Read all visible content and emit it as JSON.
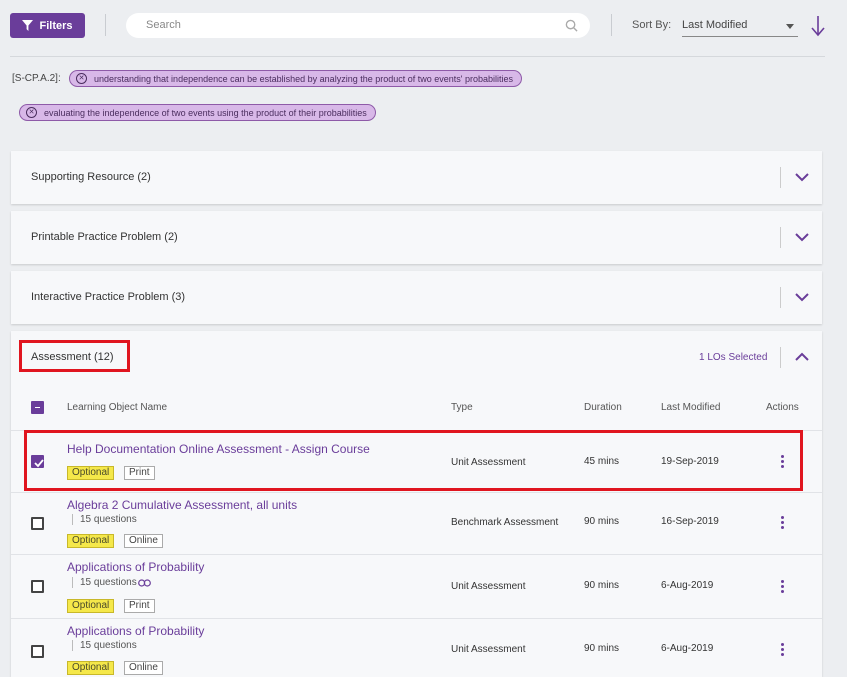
{
  "toolbar": {
    "filters_label": "Filters",
    "search_placeholder": "Search",
    "sort_label": "Sort By:",
    "sort_value": "Last Modified"
  },
  "standard": {
    "code": "[S-CP.A.2]:",
    "chips": [
      "understanding that independence can be established by analyzing the product of two events' probabilities",
      "evaluating the independence of two events using the product of their probabilities"
    ]
  },
  "sections": [
    {
      "title": "Supporting Resource (2)"
    },
    {
      "title": "Printable Practice Problem (2)"
    },
    {
      "title": "Interactive Practice Problem (3)"
    }
  ],
  "assessment": {
    "title": "Assessment (12)",
    "selected_count": "1 LOs Selected",
    "columns": [
      "Learning Object Name",
      "Type",
      "Duration",
      "Last Modified",
      "Actions"
    ],
    "rows": [
      {
        "name": "Help Documentation Online Assessment - Assign Course",
        "detail": "",
        "tags": [
          "Optional",
          "Print"
        ],
        "type": "Unit Assessment",
        "duration": "45 mins",
        "modified": "19-Sep-2019",
        "checked": true
      },
      {
        "name": "Algebra 2 Cumulative Assessment, all units",
        "detail": "15 questions",
        "tags": [
          "Optional",
          "Online"
        ],
        "type": "Benchmark Assessment",
        "duration": "90 mins",
        "modified": "16-Sep-2019",
        "checked": false
      },
      {
        "name": "Applications of Probability",
        "detail": "15 questions",
        "tags": [
          "Optional",
          "Print"
        ],
        "type": "Unit Assessment",
        "duration": "90 mins",
        "modified": "6-Aug-2019",
        "checked": false
      },
      {
        "name": "Applications of Probability",
        "detail": "15 questions",
        "tags": [
          "Optional",
          "Online"
        ],
        "type": "Unit Assessment",
        "duration": "90 mins",
        "modified": "6-Aug-2019",
        "checked": false
      }
    ]
  },
  "colors": {
    "accent": "#6a3d9a",
    "highlight": "#e0151f",
    "optional_tag": "#f5e84a",
    "chip": "#d8b8e8"
  }
}
